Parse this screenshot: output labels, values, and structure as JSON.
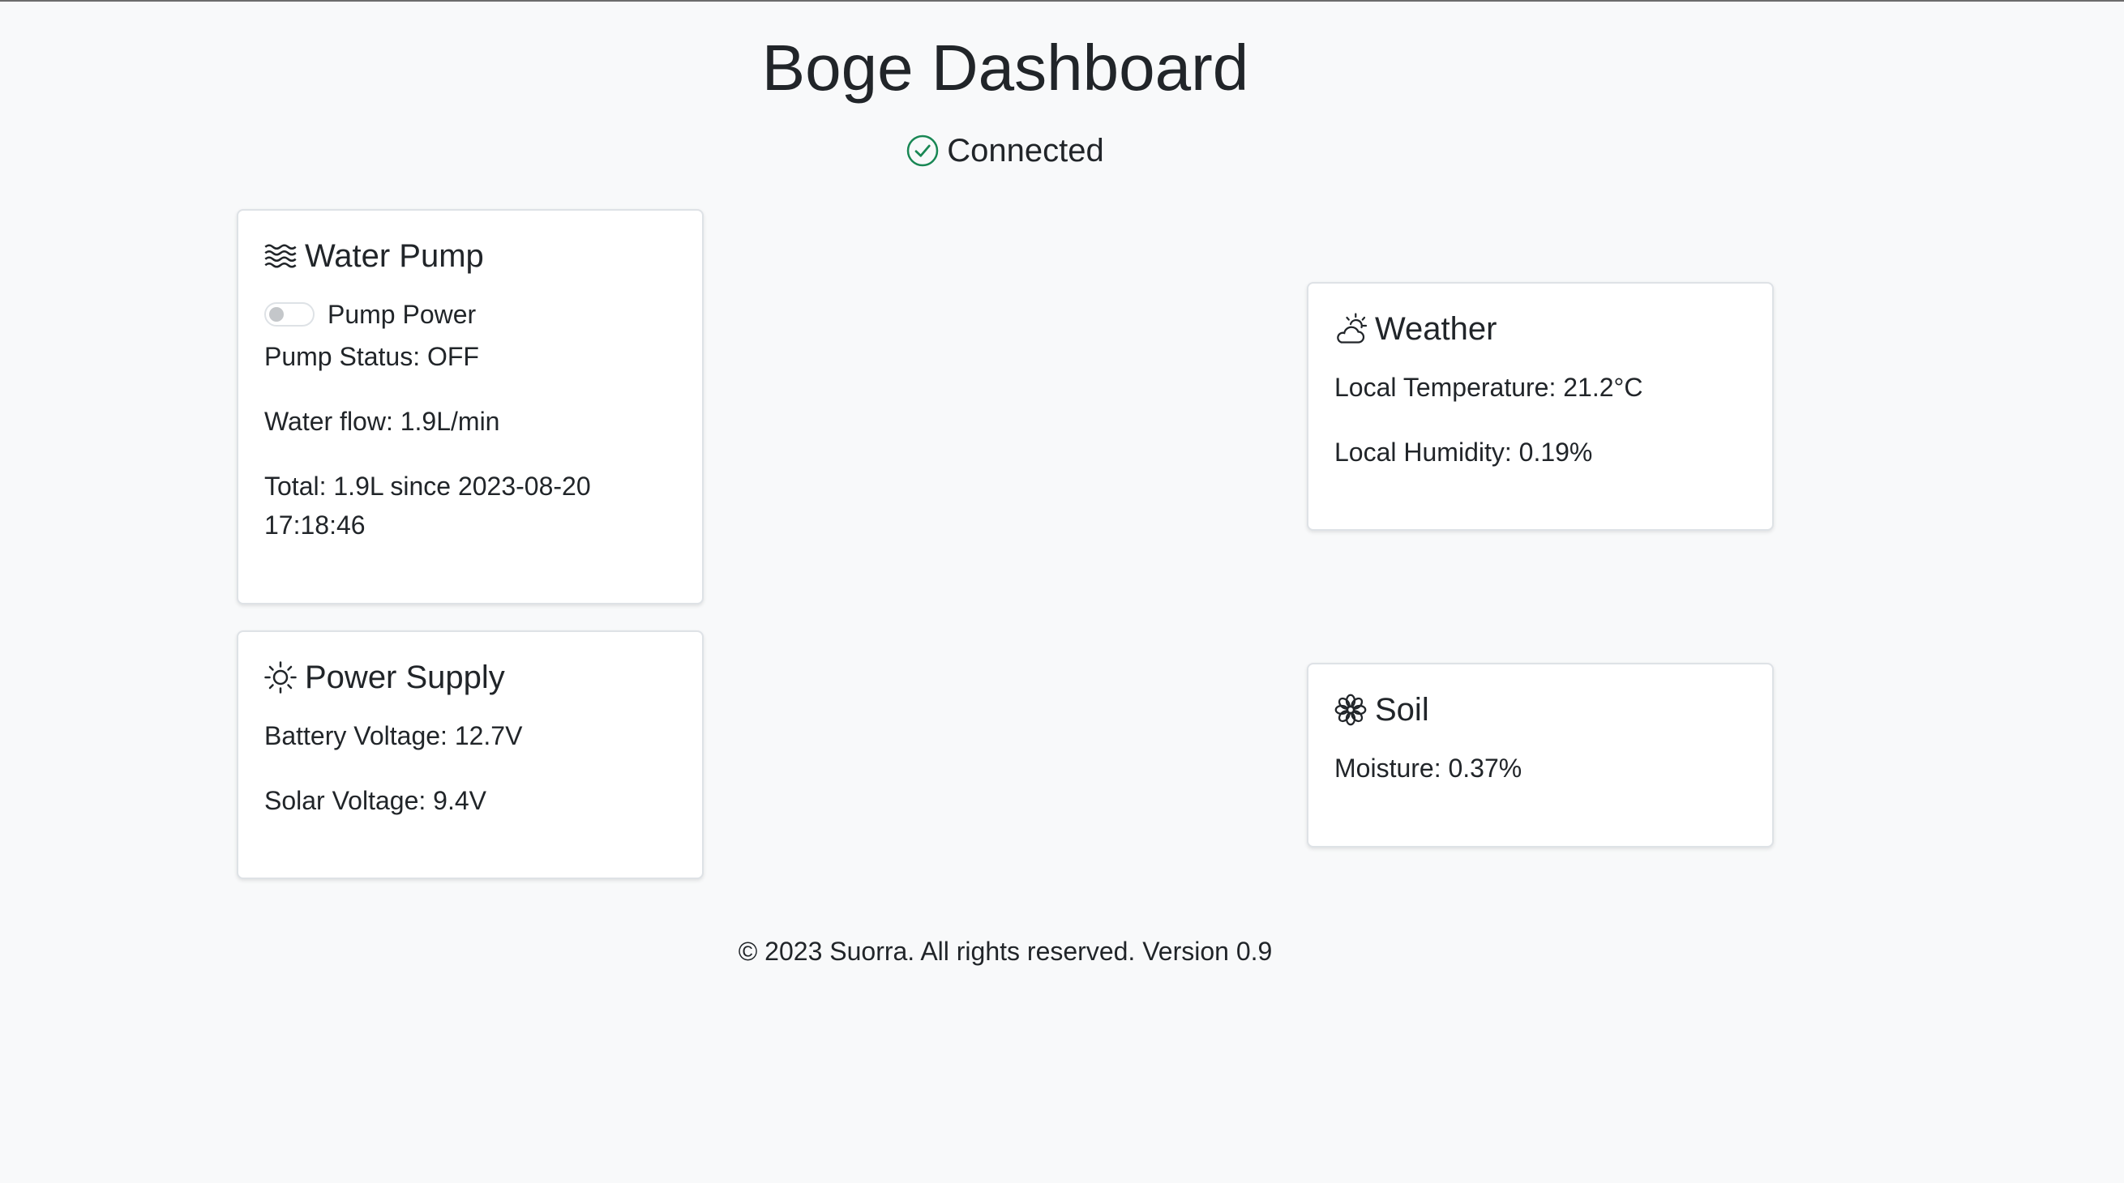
{
  "header": {
    "title": "Boge Dashboard",
    "status": "Connected",
    "status_icon": "check-circle-icon",
    "status_color": "#198754"
  },
  "water_pump": {
    "icon": "water-waves-icon",
    "title": "Water Pump",
    "toggle_label": "Pump Power",
    "toggle_on": false,
    "status": "Pump Status: OFF",
    "flow": "Water flow: 1.9L/min",
    "total_line1": "Total: 1.9L since 2023-08-20",
    "total_line2": "17:18:46"
  },
  "power_supply": {
    "icon": "sun-icon",
    "title": "Power Supply",
    "battery": "Battery Voltage: 12.7V",
    "solar": "Solar Voltage: 9.4V"
  },
  "weather": {
    "icon": "cloud-sun-icon",
    "title": "Weather",
    "temperature": "Local Temperature: 21.2°C",
    "humidity": "Local Humidity: 0.19%"
  },
  "soil": {
    "icon": "flower-icon",
    "title": "Soil",
    "moisture": "Moisture: 0.37%"
  },
  "footer": {
    "text": "© 2023 Suorra. All rights reserved. Version 0.9"
  }
}
